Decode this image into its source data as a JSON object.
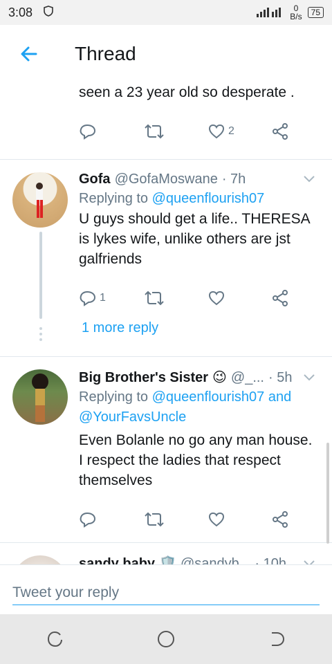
{
  "status": {
    "time": "3:08",
    "net_speed_value": "0",
    "net_speed_unit": "B/s",
    "battery": "75"
  },
  "header": {
    "title": "Thread"
  },
  "prev_tweet": {
    "text": "seen a 23 year old so desperate .",
    "like_count": "2"
  },
  "tweets": [
    {
      "name": "Gofa",
      "handle": "@GofaMoswane",
      "time": "· 7h",
      "replying_prefix": "Replying to ",
      "replying_to": "@queenflourish07",
      "text": "U guys should get a life.. THERESA is lykes wife, unlike others are jst galfriends",
      "reply_count": "1",
      "more_reply": "1 more reply"
    },
    {
      "name": "Big Brother's Sister",
      "emoji": "😉",
      "handle": "@_...",
      "time": "· 5h",
      "replying_prefix": "Replying to ",
      "replying_to": "@queenflourish07 and",
      "replying_to_2": "@YourFavsUncle",
      "text": "Even Bolanle no go any man house. I respect the ladies that respect themselves"
    },
    {
      "name": "sandy baby",
      "emoji": "🛡️",
      "handle": "@sandyb...",
      "time": "· 10h"
    }
  ],
  "reply_bar": {
    "placeholder": "Tweet your reply"
  },
  "colors": {
    "accent": "#1da1f2",
    "muted": "#657786",
    "text": "#14171a",
    "divider": "#e1e8ed"
  },
  "icons": [
    "back-arrow-icon",
    "reply-icon",
    "retweet-icon",
    "like-icon",
    "share-icon",
    "chevron-down-icon",
    "recents-icon",
    "home-icon",
    "back-nav-icon"
  ]
}
